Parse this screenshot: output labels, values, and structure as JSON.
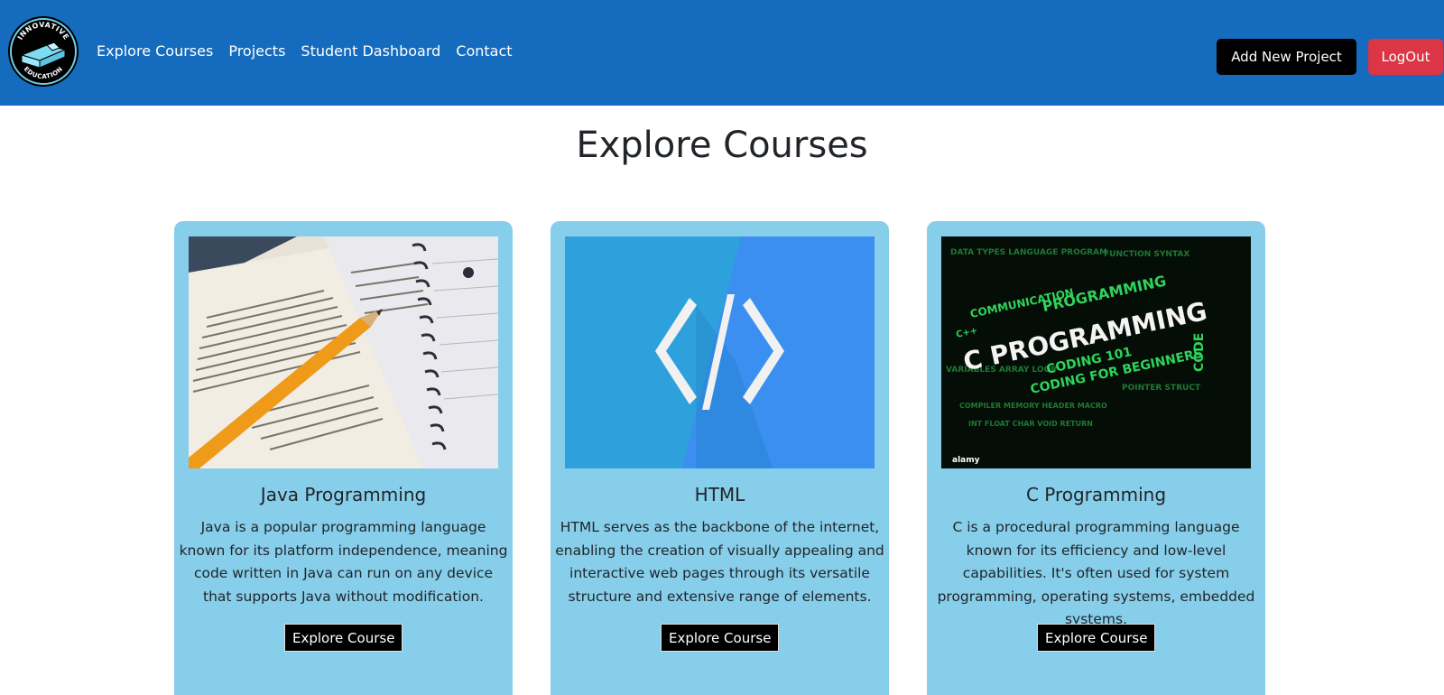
{
  "brand": {
    "logo_text_top": "INNOVATIVE",
    "logo_text_bottom": "EDUCATION"
  },
  "nav": {
    "links": [
      "Explore Courses",
      "Projects",
      "Student Dashboard",
      "Contact"
    ],
    "add_project_label": "Add New Project",
    "logout_label": "LogOut"
  },
  "page": {
    "title": "Explore Courses"
  },
  "courses": [
    {
      "title": "Java Programming",
      "description": "Java is a popular programming language known for its platform independence, meaning code written in Java can run on any device that supports Java without modification.",
      "button": "Explore Course"
    },
    {
      "title": "HTML",
      "description": "HTML serves as the backbone of the internet, enabling the creation of visually appealing and interactive web pages through its versatile structure and extensive range of elements.",
      "button": "Explore Course"
    },
    {
      "title": "C Programming",
      "description": "C is a procedural programming language known for its efficiency and low-level capabilities. It's often used for system programming, operating systems, embedded systems.",
      "button": "Explore Course"
    }
  ],
  "images": {
    "c_image_main": "C PROGRAMMING",
    "c_image_words": [
      "COMMUNICATION",
      "PROGRAMMING",
      "CODING 101",
      "CODING FOR BEGINNERS",
      "CODE",
      "C++"
    ],
    "c_image_watermark": "alamy"
  },
  "colors": {
    "navbar": "#156bbd",
    "card": "#87ceeb",
    "logout": "#dc3545",
    "add_project": "#000000"
  }
}
